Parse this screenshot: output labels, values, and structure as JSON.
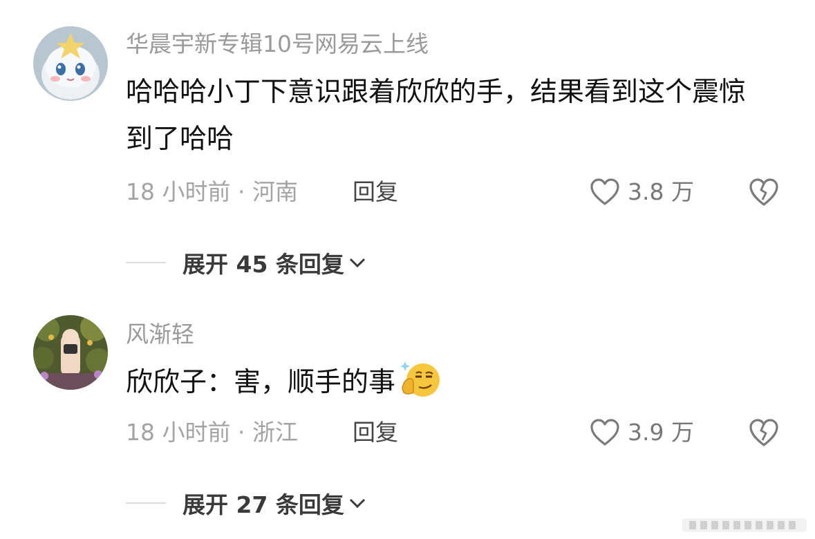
{
  "comments": [
    {
      "username": "华晨宇新专辑10号网易云上线",
      "text": "哈哈哈小丁下意识跟着欣欣的手，结果看到这个震惊到了哈哈",
      "meta": "18 小时前 · 河南",
      "reply_label": "回复",
      "like_count": "3.8 万",
      "expand_label": "展开 45 条回复",
      "avatar_icon": "plush-doll-avatar"
    },
    {
      "username": "风渐轻",
      "text": "欣欣子：害，顺手的事",
      "emoji_icon": "smug-face-emoji",
      "meta": "18 小时前 · 浙江",
      "reply_label": "回复",
      "like_count": "3.9 万",
      "expand_label": "展开 27 条回复",
      "avatar_icon": "photo-avatar"
    }
  ],
  "colors": {
    "username": "#9a9a9a",
    "text": "#111111",
    "meta": "#a3a3a3",
    "icon": "#7a7a7a"
  }
}
